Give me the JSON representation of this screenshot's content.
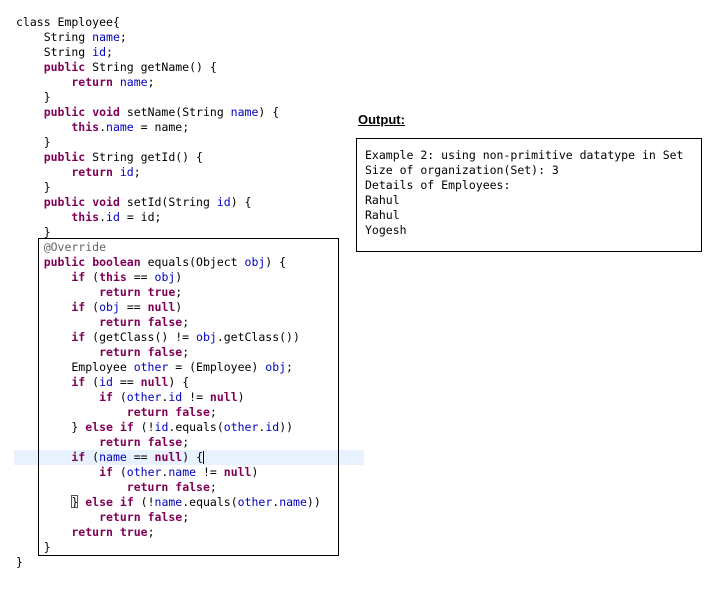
{
  "code": [
    [
      [
        "t",
        "class Employee{"
      ]
    ],
    [
      [
        "t",
        "    String "
      ],
      [
        "fld",
        "name"
      ],
      [
        "t",
        ";"
      ]
    ],
    [
      [
        "t",
        "    String "
      ],
      [
        "fld",
        "id"
      ],
      [
        "t",
        ";"
      ]
    ],
    [
      [
        "kw",
        "    public"
      ],
      [
        "t",
        " String getName() {"
      ]
    ],
    [
      [
        "kw",
        "        return"
      ],
      [
        "t",
        " "
      ],
      [
        "fld",
        "name"
      ],
      [
        "t",
        ";"
      ]
    ],
    [
      [
        "t",
        "    }"
      ]
    ],
    [
      [
        "kw",
        "    public"
      ],
      [
        "t",
        " "
      ],
      [
        "kw",
        "void"
      ],
      [
        "t",
        " setName(String "
      ],
      [
        "fld",
        "name"
      ],
      [
        "t",
        ") {"
      ]
    ],
    [
      [
        "kw",
        "        this"
      ],
      [
        "t",
        "."
      ],
      [
        "fld",
        "name"
      ],
      [
        "t",
        " = "
      ],
      [
        "t",
        "name"
      ],
      [
        "t",
        ";"
      ]
    ],
    [
      [
        "t",
        "    }"
      ]
    ],
    [
      [
        "kw",
        "    public"
      ],
      [
        "t",
        " String getId() {"
      ]
    ],
    [
      [
        "kw",
        "        return"
      ],
      [
        "t",
        " "
      ],
      [
        "fld",
        "id"
      ],
      [
        "t",
        ";"
      ]
    ],
    [
      [
        "t",
        "    }"
      ]
    ],
    [
      [
        "kw",
        "    public"
      ],
      [
        "t",
        " "
      ],
      [
        "kw",
        "void"
      ],
      [
        "t",
        " setId(String "
      ],
      [
        "fld",
        "id"
      ],
      [
        "t",
        ") {"
      ]
    ],
    [
      [
        "kw",
        "        this"
      ],
      [
        "t",
        "."
      ],
      [
        "fld",
        "id"
      ],
      [
        "t",
        " = "
      ],
      [
        "t",
        "id"
      ],
      [
        "t",
        ";"
      ]
    ],
    [
      [
        "t",
        "    }"
      ]
    ],
    [
      [
        "ann",
        "    @Override"
      ]
    ],
    [
      [
        "kw",
        "    public"
      ],
      [
        "t",
        " "
      ],
      [
        "kw",
        "boolean"
      ],
      [
        "t",
        " equals(Object "
      ],
      [
        "fld",
        "obj"
      ],
      [
        "t",
        ") {"
      ]
    ],
    [
      [
        "kw",
        "        if"
      ],
      [
        "t",
        " ("
      ],
      [
        "kw",
        "this"
      ],
      [
        "t",
        " == "
      ],
      [
        "fld",
        "obj"
      ],
      [
        "t",
        ")"
      ]
    ],
    [
      [
        "kw",
        "            return"
      ],
      [
        "t",
        " "
      ],
      [
        "kw",
        "true"
      ],
      [
        "t",
        ";"
      ]
    ],
    [
      [
        "kw",
        "        if"
      ],
      [
        "t",
        " ("
      ],
      [
        "fld",
        "obj"
      ],
      [
        "t",
        " == "
      ],
      [
        "kw",
        "null"
      ],
      [
        "t",
        ")"
      ]
    ],
    [
      [
        "kw",
        "            return"
      ],
      [
        "t",
        " "
      ],
      [
        "kw",
        "false"
      ],
      [
        "t",
        ";"
      ]
    ],
    [
      [
        "kw",
        "        if"
      ],
      [
        "t",
        " (getClass() != "
      ],
      [
        "fld",
        "obj"
      ],
      [
        "t",
        ".getClass())"
      ]
    ],
    [
      [
        "kw",
        "            return"
      ],
      [
        "t",
        " "
      ],
      [
        "kw",
        "false"
      ],
      [
        "t",
        ";"
      ]
    ],
    [
      [
        "t",
        "        Employee "
      ],
      [
        "fld",
        "other"
      ],
      [
        "t",
        " = (Employee) "
      ],
      [
        "fld",
        "obj"
      ],
      [
        "t",
        ";"
      ]
    ],
    [
      [
        "kw",
        "        if"
      ],
      [
        "t",
        " ("
      ],
      [
        "fld",
        "id"
      ],
      [
        "t",
        " == "
      ],
      [
        "kw",
        "null"
      ],
      [
        "t",
        ") {"
      ]
    ],
    [
      [
        "kw",
        "            if"
      ],
      [
        "t",
        " ("
      ],
      [
        "fld",
        "other"
      ],
      [
        "t",
        "."
      ],
      [
        "fld",
        "id"
      ],
      [
        "t",
        " != "
      ],
      [
        "kw",
        "null"
      ],
      [
        "t",
        ")"
      ]
    ],
    [
      [
        "kw",
        "                return"
      ],
      [
        "t",
        " "
      ],
      [
        "kw",
        "false"
      ],
      [
        "t",
        ";"
      ]
    ],
    [
      [
        "t",
        "        } "
      ],
      [
        "kw",
        "else"
      ],
      [
        "t",
        " "
      ],
      [
        "kw",
        "if"
      ],
      [
        "t",
        " (!"
      ],
      [
        "fld",
        "id"
      ],
      [
        "t",
        ".equals("
      ],
      [
        "fld",
        "other"
      ],
      [
        "t",
        "."
      ],
      [
        "fld",
        "id"
      ],
      [
        "t",
        "))"
      ]
    ],
    [
      [
        "kw",
        "            return"
      ],
      [
        "t",
        " "
      ],
      [
        "kw",
        "false"
      ],
      [
        "t",
        ";"
      ]
    ],
    [
      [
        "kw",
        "        if"
      ],
      [
        "t",
        " ("
      ],
      [
        "fld",
        "name"
      ],
      [
        "t",
        " == "
      ],
      [
        "kw",
        "null"
      ],
      [
        "t",
        ") {"
      ]
    ],
    [
      [
        "kw",
        "            if"
      ],
      [
        "t",
        " ("
      ],
      [
        "fld",
        "other"
      ],
      [
        "t",
        "."
      ],
      [
        "fld",
        "name"
      ],
      [
        "t",
        " != "
      ],
      [
        "kw",
        "null"
      ],
      [
        "t",
        ")"
      ]
    ],
    [
      [
        "kw",
        "                return"
      ],
      [
        "t",
        " "
      ],
      [
        "kw",
        "false"
      ],
      [
        "t",
        ";"
      ]
    ],
    [
      [
        "t",
        "        } "
      ],
      [
        "kw",
        "else"
      ],
      [
        "t",
        " "
      ],
      [
        "kw",
        "if"
      ],
      [
        "t",
        " (!"
      ],
      [
        "fld",
        "name"
      ],
      [
        "t",
        ".equals("
      ],
      [
        "fld",
        "other"
      ],
      [
        "t",
        "."
      ],
      [
        "fld",
        "name"
      ],
      [
        "t",
        "))"
      ]
    ],
    [
      [
        "kw",
        "            return"
      ],
      [
        "t",
        " "
      ],
      [
        "kw",
        "false"
      ],
      [
        "t",
        ";"
      ]
    ],
    [
      [
        "kw",
        "        return"
      ],
      [
        "t",
        " "
      ],
      [
        "kw",
        "true"
      ],
      [
        "t",
        ";"
      ]
    ],
    [
      [
        "t",
        "    }"
      ]
    ],
    [
      [
        "t",
        "}"
      ]
    ]
  ],
  "output": {
    "label": "Output:",
    "lines": [
      "Example 2: using non-primitive datatype in Set",
      "Size of organization(Set): 3",
      "Details of Employees:",
      "Rahul",
      "Rahul",
      "Yogesh"
    ]
  }
}
